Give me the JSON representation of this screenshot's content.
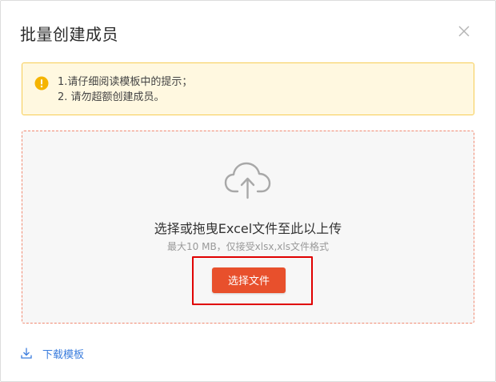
{
  "dialog": {
    "title": "批量创建成员",
    "close_icon": "close-icon"
  },
  "alert": {
    "icon": "warning-icon",
    "lines": [
      "1.请仔细阅读模板中的提示；",
      "2. 请勿超额创建成员。"
    ],
    "colors": {
      "background": "#fff8e0",
      "border": "#f7cd55",
      "icon": "#f5b400"
    }
  },
  "upload": {
    "icon": "cloud-upload-icon",
    "title": "选择或拖曳Excel文件至此以上传",
    "hint": "最大10 MB，仅接受xlsx,xls文件格式",
    "button_label": "选择文件",
    "colors": {
      "button": "#e8502c",
      "border": "#f08a72"
    }
  },
  "footer": {
    "download_icon": "download-icon",
    "download_label": "下载模板",
    "link_color": "#3b7ddd"
  },
  "highlight_color": "#e00000"
}
